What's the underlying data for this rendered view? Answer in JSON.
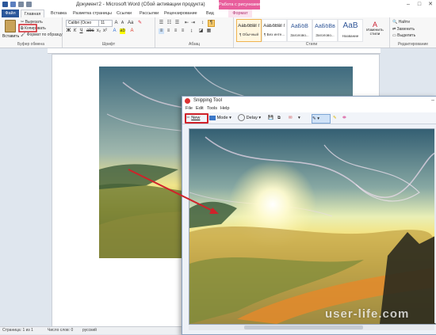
{
  "window": {
    "title": "Документ2 - Microsoft Word (Сбой активации продукта)",
    "context_tab_header": "Работа с рисунками",
    "controls": [
      "–",
      "□",
      "✕"
    ]
  },
  "ribbon_tabs": {
    "file": "Файл",
    "home": "Главная",
    "insert": "Вставка",
    "page_layout": "Разметка страницы",
    "references": "Ссылки",
    "mailings": "Рассылки",
    "review": "Рецензирование",
    "view": "Вид",
    "format": "Формат"
  },
  "clipboard": {
    "paste": "Вставить",
    "cut": "Вырезать",
    "copy": "Копировать",
    "format_painter": "Формат по образцу",
    "group_label": "Буфер обмена"
  },
  "font": {
    "name": "Calibri (Осно",
    "size": "11",
    "group_label": "Шрифт"
  },
  "paragraph": {
    "group_label": "Абзац"
  },
  "styles": {
    "items": [
      {
        "sample": "АаБбВвГг",
        "name": "¶ Обычный"
      },
      {
        "sample": "АаБбВвГг",
        "name": "¶ Без инте..."
      },
      {
        "sample": "АаБбВ",
        "name": "Заголово..."
      },
      {
        "sample": "АаБбВв",
        "name": "Заголово..."
      },
      {
        "sample": "АаВ",
        "name": "Название"
      }
    ],
    "change_styles": "Изменить стили",
    "group_label": "Стили"
  },
  "editing": {
    "find": "Найти",
    "replace": "Заменить",
    "select": "Выделить",
    "group_label": "Редактирование"
  },
  "statusbar": {
    "page": "Страница: 1 из 1",
    "words": "Число слов: 0",
    "language": "русский"
  },
  "snipping_tool": {
    "title": "Snipping Tool",
    "menu": [
      "File",
      "Edit",
      "Tools",
      "Help"
    ],
    "new": "New",
    "mode": "Mode",
    "delay": "Delay"
  },
  "watermark": "user-life.com",
  "colors": {
    "word_blue": "#2b579a",
    "format_tab_pink": "#e85e9c",
    "highlight_red": "#d0222a"
  }
}
